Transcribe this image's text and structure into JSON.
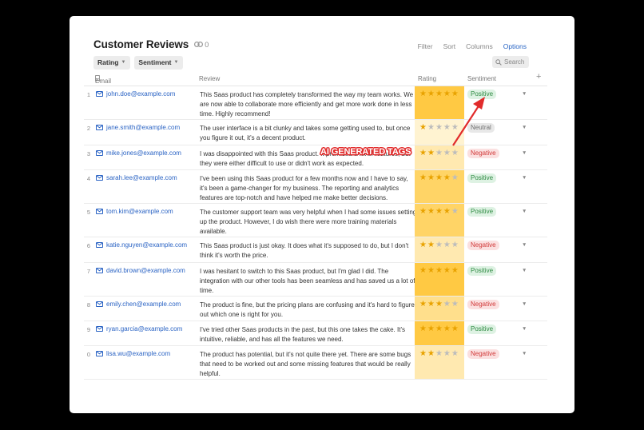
{
  "app": {
    "title": "Customer Reviews",
    "link_count": "0",
    "actions": [
      "Filter",
      "Sort",
      "Columns",
      "Options"
    ],
    "active_action": "Options",
    "filters": [
      {
        "label": "Rating"
      },
      {
        "label": "Sentiment"
      }
    ],
    "search_placeholder": "Search"
  },
  "columns": {
    "email": "Email",
    "review": "Review",
    "rating": "Rating",
    "sentiment": "Sentiment",
    "add": "+"
  },
  "rows": [
    {
      "num": "1",
      "email": "john.doe@example.com",
      "review": "This Saas product has completely transformed the way my team works. We are now able to collaborate more efficiently and get more work done in less time. Highly recommend!",
      "rating": 5,
      "sentiment": "Positive"
    },
    {
      "num": "2",
      "email": "jane.smith@example.com",
      "review": "The user interface is a bit clunky and takes some getting used to, but once you figure it out, it's a decent product.",
      "rating": 1,
      "sentiment": "Neutral"
    },
    {
      "num": "3",
      "email": "mike.jones@example.com",
      "review": "I was disappointed with this Saas product. It promised a lot of features, but they were either difficult to use or didn't work as expected.",
      "rating": 2,
      "sentiment": "Negative"
    },
    {
      "num": "4",
      "email": "sarah.lee@example.com",
      "review": "I've been using this Saas product for a few months now and I have to say, it's been a game-changer for my business. The reporting and analytics features are top-notch and have helped me make better decisions.",
      "rating": 4,
      "sentiment": "Positive"
    },
    {
      "num": "5",
      "email": "tom.kim@example.com",
      "review": "The customer support team was very helpful when I had some issues setting up the product. However, I do wish there were more training materials available.",
      "rating": 4,
      "sentiment": "Positive"
    },
    {
      "num": "6",
      "email": "katie.nguyen@example.com",
      "review": "This Saas product is just okay. It does what it's supposed to do, but I don't think it's worth the price.",
      "rating": 2,
      "sentiment": "Negative"
    },
    {
      "num": "7",
      "email": "david.brown@example.com",
      "review": "I was hesitant to switch to this Saas product, but I'm glad I did. The integration with our other tools has been seamless and has saved us a lot of time.",
      "rating": 5,
      "sentiment": "Positive"
    },
    {
      "num": "8",
      "email": "emily.chen@example.com",
      "review": "The product is fine, but the pricing plans are confusing and it's hard to figure out which one is right for you.",
      "rating": 3,
      "sentiment": "Negative"
    },
    {
      "num": "9",
      "email": "ryan.garcia@example.com",
      "review": "I've tried other Saas products in the past, but this one takes the cake. It's intuitive, reliable, and has all the features we need.",
      "rating": 5,
      "sentiment": "Positive"
    },
    {
      "num": "0",
      "email": "lisa.wu@example.com",
      "review": "The product has potential, but it's not quite there yet. There are some bugs that need to be worked out and some missing features that would be really helpful.",
      "rating": 2,
      "sentiment": "Negative"
    }
  ],
  "annotation": "AI GENERATED TAGS",
  "colors": {
    "link": "#2a63c4",
    "star": "#e8a200",
    "annotation": "#e12b2b",
    "rating_heat": [
      "#fff3d1",
      "#ffe9b0",
      "#ffdf8c",
      "#ffd466",
      "#ffc943"
    ]
  }
}
